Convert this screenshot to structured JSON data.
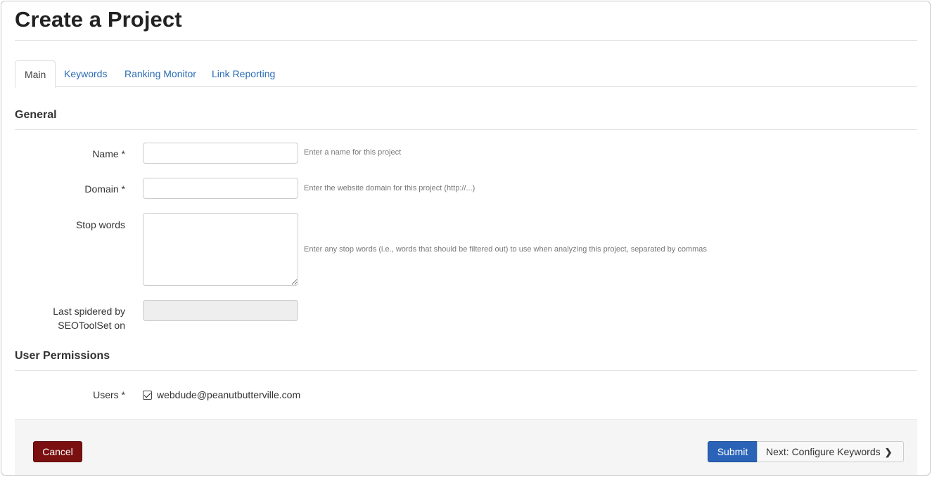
{
  "page": {
    "title": "Create a Project"
  },
  "tabs": [
    {
      "label": "Main",
      "active": true
    },
    {
      "label": "Keywords",
      "active": false
    },
    {
      "label": "Ranking Monitor",
      "active": false
    },
    {
      "label": "Link Reporting",
      "active": false
    }
  ],
  "general": {
    "title": "General",
    "name": {
      "label": "Name *",
      "value": "",
      "help": "Enter a name for this project"
    },
    "domain": {
      "label": "Domain *",
      "value": "",
      "help": "Enter the website domain for this project (http://...)"
    },
    "stop_words": {
      "label": "Stop words",
      "value": "",
      "help": "Enter any stop words (i.e., words that should be filtered out) to use when analyzing this project, separated by commas"
    },
    "last_spidered": {
      "label_line1": "Last spidered by",
      "label_line2": "SEOToolSet on",
      "value": ""
    }
  },
  "permissions": {
    "title": "User Permissions",
    "users_label": "Users *",
    "users": [
      {
        "email": "webdude@peanutbutterville.com",
        "checked": true
      }
    ]
  },
  "footer": {
    "cancel_label": "Cancel",
    "submit_label": "Submit",
    "next_label": "Next: Configure Keywords",
    "next_icon": "chevron-right-icon"
  },
  "colors": {
    "link": "#2a6bb4",
    "cancel": "#7a1010",
    "submit": "#2a63b8"
  }
}
